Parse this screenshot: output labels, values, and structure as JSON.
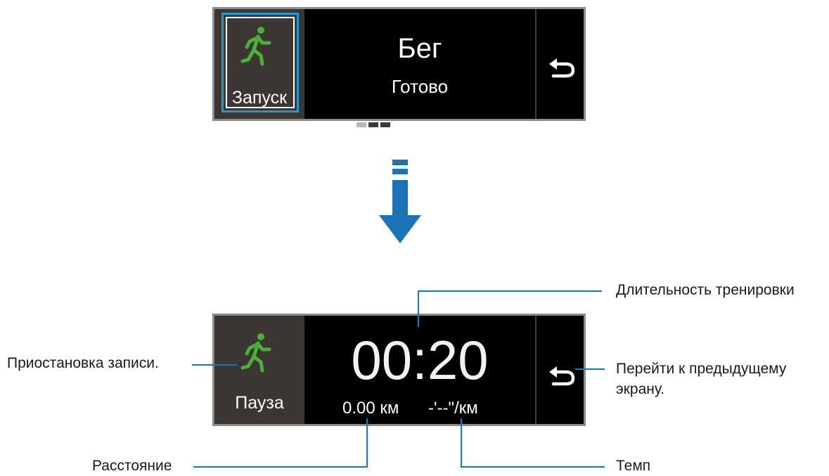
{
  "top_screen": {
    "action_label": "Запуск",
    "title": "Бег",
    "status": "Готово",
    "pages": 3,
    "active_page": 1
  },
  "bottom_screen": {
    "action_label": "Пауза",
    "timer": "00:20",
    "distance": "0.00 км",
    "pace": "-'--\"/км"
  },
  "callouts": {
    "pause": "Приостановка записи.",
    "duration": "Длительность тренировки",
    "back_line1": "Перейти к предыдущему",
    "back_line2": "экрану.",
    "distance": "Расстояние",
    "pace": "Темп"
  },
  "colors": {
    "accent_blue": "#1c72b6",
    "runner_green": "#4caf3a",
    "action_panel": "#3b3631"
  },
  "icons": [
    "runner-icon",
    "back-icon",
    "down-arrow-icon"
  ]
}
